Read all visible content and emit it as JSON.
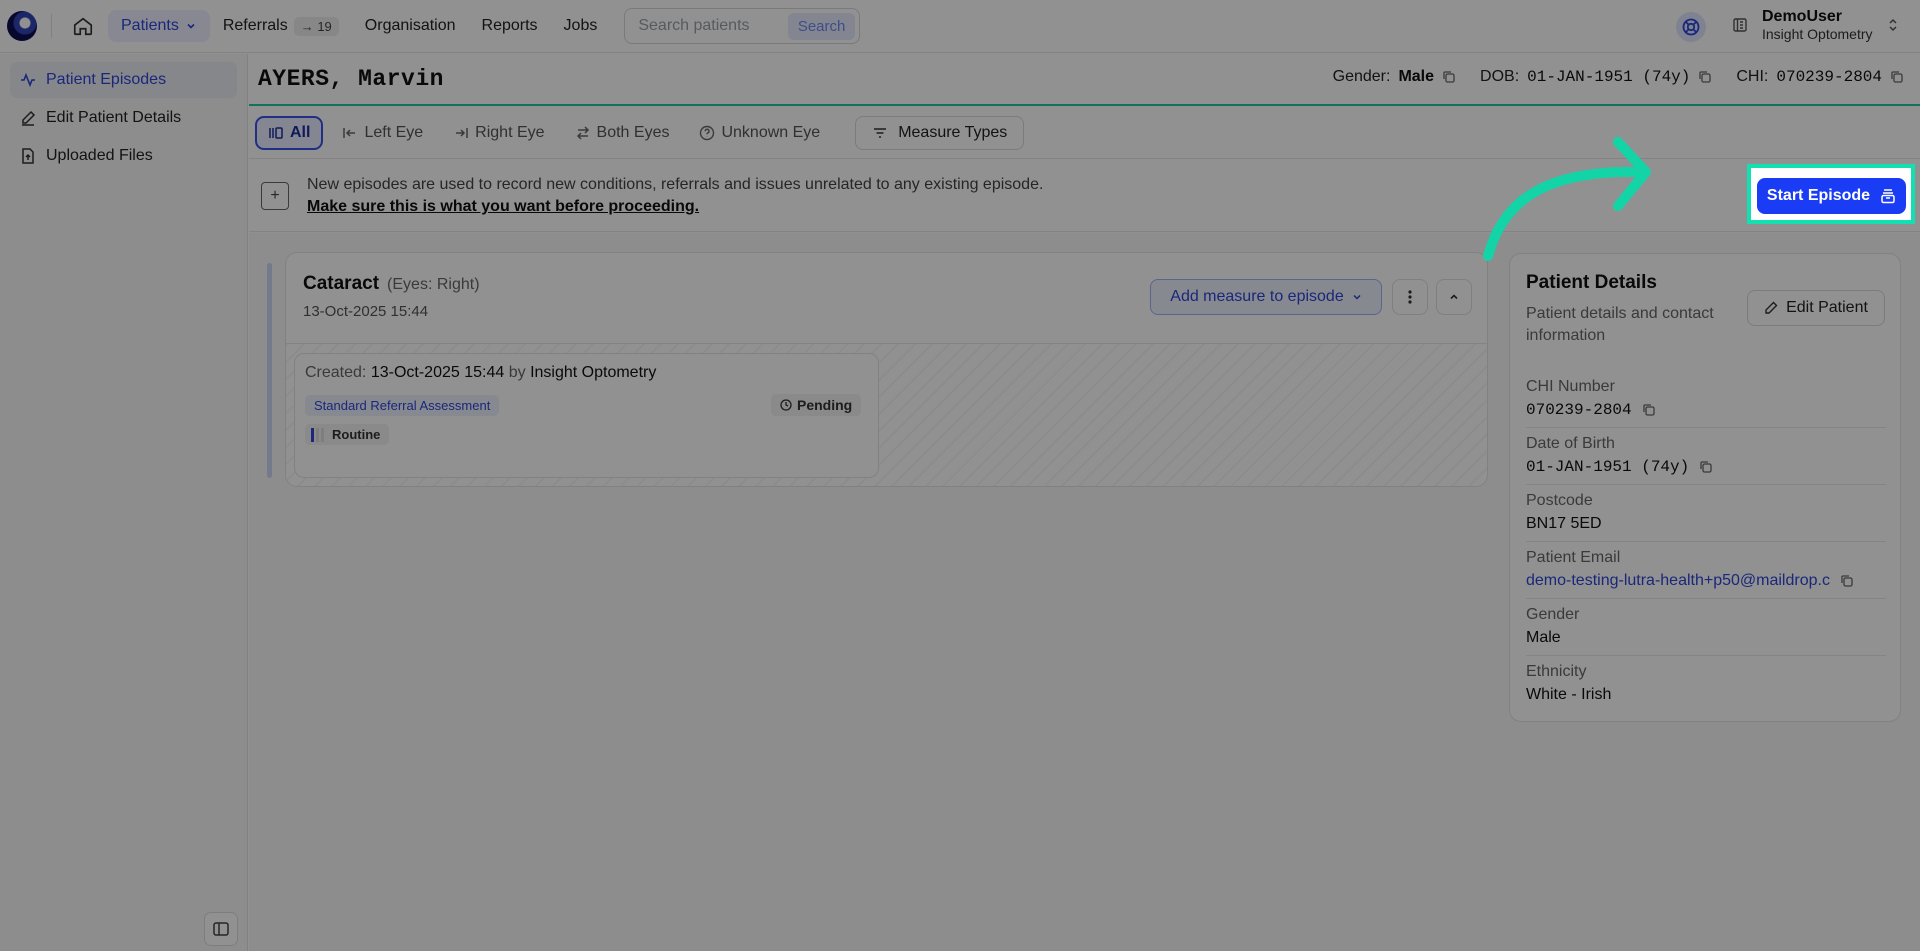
{
  "topbar": {
    "nav": [
      {
        "label": "Patients"
      },
      {
        "label": "Referrals",
        "badge": "→ 19"
      },
      {
        "label": "Organisation"
      },
      {
        "label": "Reports"
      },
      {
        "label": "Jobs"
      }
    ],
    "search": {
      "placeholder": "Search patients",
      "button": "Search"
    },
    "user": {
      "name": "DemoUser",
      "org": "Insight Optometry"
    }
  },
  "sidebar": {
    "items": [
      {
        "label": "Patient Episodes"
      },
      {
        "label": "Edit Patient Details"
      },
      {
        "label": "Uploaded Files"
      }
    ]
  },
  "header": {
    "name": "AYERS, Marvin",
    "gender_label": "Gender:",
    "gender": "Male",
    "dob_label": "DOB:",
    "dob": "01-JAN-1951 (74y)",
    "chi_label": "CHI:",
    "chi": "070239-2804"
  },
  "filters": {
    "tabs": [
      {
        "label": "All"
      },
      {
        "label": "Left Eye"
      },
      {
        "label": "Right Eye"
      },
      {
        "label": "Both Eyes"
      },
      {
        "label": "Unknown Eye"
      }
    ],
    "measure_types": "Measure Types"
  },
  "banner": {
    "text": "New episodes are used to record new conditions, referrals and issues unrelated to any existing episode.",
    "warning": "Make sure this is what you want before proceeding.",
    "start_button": "Start Episode"
  },
  "episode": {
    "title": "Cataract",
    "eyes": "(Eyes: Right)",
    "date": "13-Oct-2025 15:44",
    "add_measure": "Add measure to episode",
    "measure": {
      "created_prefix": "Created:",
      "created_date": "13-Oct-2025 15:44",
      "by": "by",
      "author": "Insight Optometry",
      "tag": "Standard Referral Assessment",
      "status": "Pending",
      "priority": "Routine"
    }
  },
  "details": {
    "title": "Patient Details",
    "subtitle": "Patient details and contact information",
    "edit_button": "Edit Patient",
    "fields": [
      {
        "label": "CHI Number",
        "value": "070239-2804"
      },
      {
        "label": "Date of Birth",
        "value": "01-JAN-1951 (74y)"
      },
      {
        "label": "Postcode",
        "value": "BN17 5ED"
      },
      {
        "label": "Patient Email",
        "value": "demo-testing-lutra-health+p50@maildrop.c"
      },
      {
        "label": "Gender",
        "value": "Male"
      },
      {
        "label": "Ethnicity",
        "value": "White - Irish"
      }
    ]
  },
  "colors": {
    "accent": "#2e46d6",
    "highlight": "#13e0b0",
    "primary_button": "#1b3cf5",
    "header_rule": "#22c7a6"
  }
}
